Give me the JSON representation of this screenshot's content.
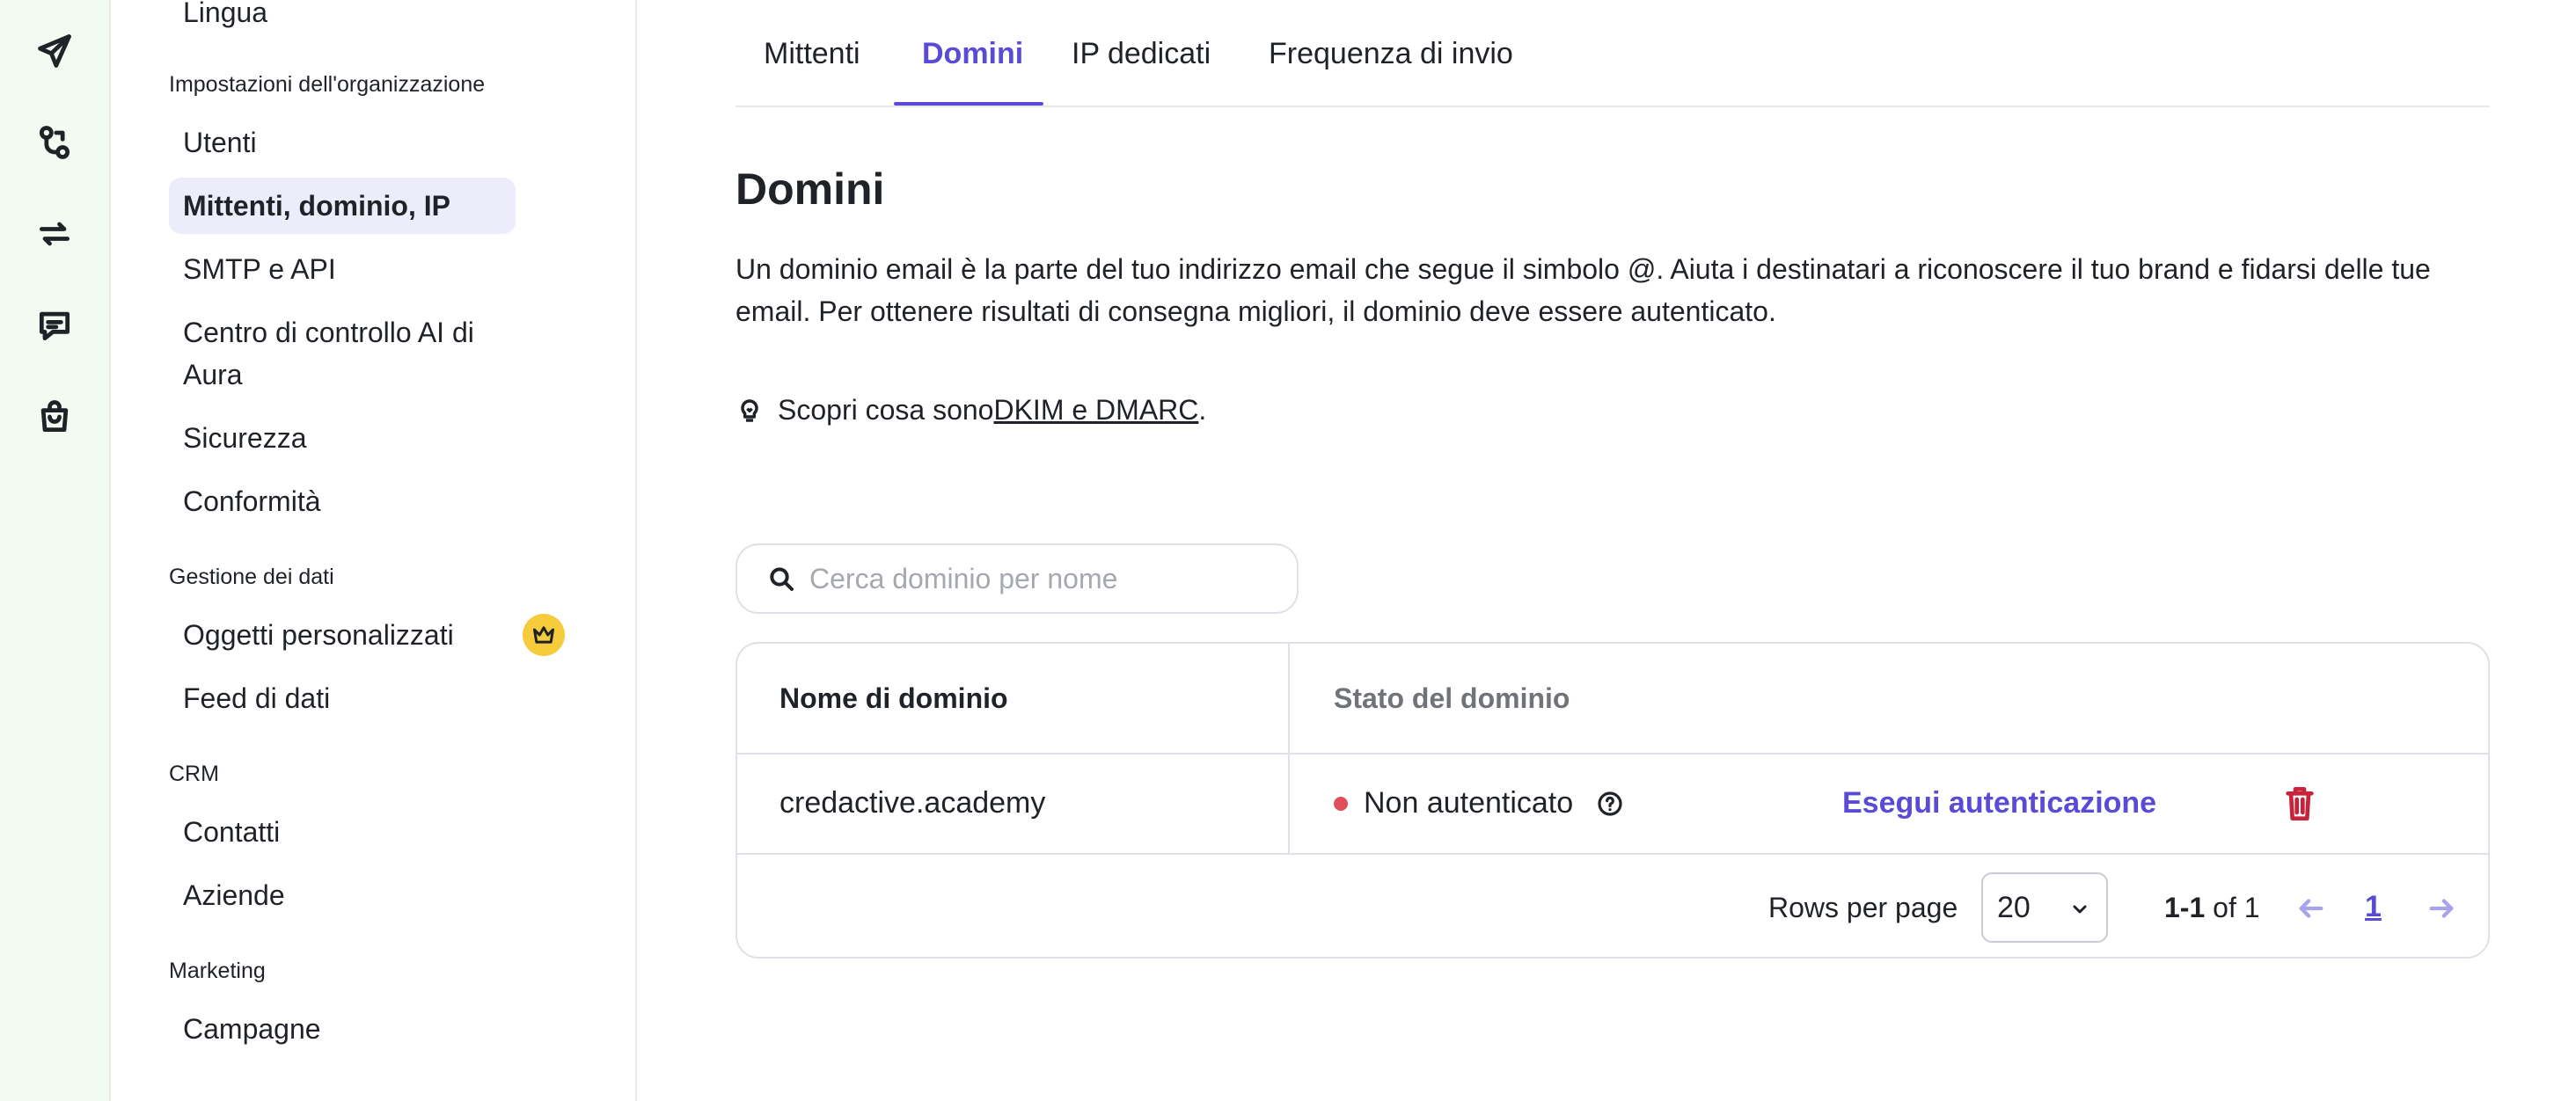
{
  "rail": {
    "icons": [
      "send-icon",
      "automation-icon",
      "sync-icon",
      "conversations-icon",
      "shopping-bag-icon"
    ]
  },
  "sidebar": {
    "top_item": "Lingua",
    "groups": [
      {
        "title": "Impostazioni dell'organizzazione",
        "items": [
          "Utenti",
          "Mittenti, dominio, IP",
          "SMTP e API",
          "Centro di controllo AI di Aura",
          "Sicurezza",
          "Conformità"
        ]
      },
      {
        "title": "Gestione dei dati",
        "items": [
          "Oggetti personalizzati",
          "Feed di dati"
        ]
      },
      {
        "title": "CRM",
        "items": [
          "Contatti",
          "Aziende"
        ]
      },
      {
        "title": "Marketing",
        "items": [
          "Campagne"
        ]
      }
    ],
    "active_item": "Mittenti, dominio, IP",
    "premium_badge_icon": "crown-icon"
  },
  "tabs": [
    "Mittenti",
    "Domini",
    "IP dedicati",
    "Frequenza di invio"
  ],
  "active_tab": "Domini",
  "page": {
    "title": "Domini",
    "description": "Un dominio email è la parte del tuo indirizzo email che segue il simbolo @. Aiuta i destinatari a riconoscere il tuo brand e fidarsi delle tue email. Per ottenere risultati di consegna migliori, il dominio deve essere autenticato.",
    "learn_prefix": "Scopri cosa sono ",
    "learn_link": "DKIM e DMARC",
    "learn_suffix": "."
  },
  "search": {
    "placeholder": "Cerca dominio per nome"
  },
  "table": {
    "headers": [
      "Nome di dominio",
      "Stato del dominio"
    ],
    "rows": [
      {
        "domain": "credactive.academy",
        "status": "Non autenticato",
        "action": "Esegui autenticazione"
      }
    ]
  },
  "pagination": {
    "rows_per_page_label": "Rows per page",
    "rows_per_page": "20",
    "range": "1-1",
    "of_text": "of 1",
    "current_page": "1"
  },
  "colors": {
    "accent": "#5b4ad6",
    "rail_bg": "#f2fbf1",
    "active_item_bg": "#ececfb",
    "status_dot": "#e04e5c",
    "delete": "#c8233a",
    "crown_bg": "#f6cc3c"
  }
}
